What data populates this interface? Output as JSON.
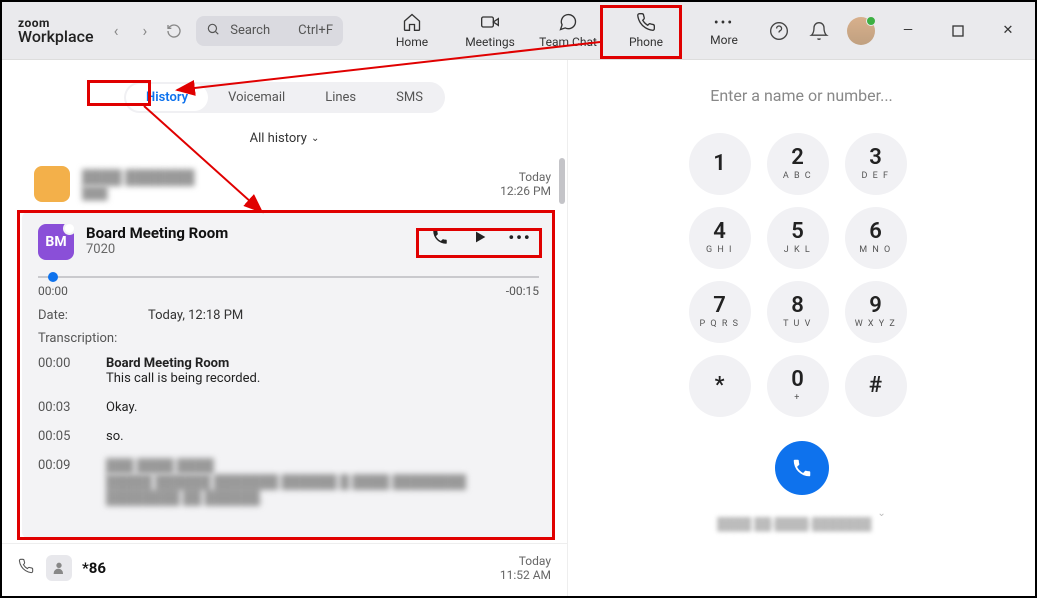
{
  "app": {
    "brand_top": "zoom",
    "brand_bottom": "Workplace"
  },
  "search": {
    "label": "Search",
    "shortcut": "Ctrl+F"
  },
  "nav": {
    "home": "Home",
    "meetings": "Meetings",
    "team_chat": "Team Chat",
    "phone": "Phone",
    "more": "More"
  },
  "sub_tabs": {
    "history": "History",
    "voicemail": "Voicemail",
    "lines": "Lines",
    "sms": "SMS"
  },
  "filter": {
    "label": "All history"
  },
  "entries": {
    "first": {
      "name": "████ ███████",
      "ext": "███",
      "time_day": "Today",
      "time_clock": "12:26 PM"
    },
    "last": {
      "name": "*86",
      "time_day": "Today",
      "time_clock": "11:52 AM"
    }
  },
  "detail": {
    "initials": "BM",
    "name": "Board Meeting Room",
    "ext": "7020",
    "progress": {
      "elapsed": "00:00",
      "remaining": "-00:15"
    },
    "date_label": "Date:",
    "date_value": "Today, 12:18 PM",
    "transcription_label": "Transcription:",
    "lines": [
      {
        "ts": "00:00",
        "speaker": "Board Meeting Room",
        "text": "This call is being recorded."
      },
      {
        "ts": "00:03",
        "speaker": "",
        "text": "Okay."
      },
      {
        "ts": "00:05",
        "speaker": "",
        "text": "so."
      },
      {
        "ts": "00:09",
        "speaker": "███ ████ ████",
        "text": "█████ ██████ ███████ ██████ █ ████ ████████ ████████ ██ ██████."
      }
    ]
  },
  "dialer": {
    "placeholder": "Enter a name or number...",
    "keys": [
      {
        "n": "1",
        "l": ""
      },
      {
        "n": "2",
        "l": "A B C"
      },
      {
        "n": "3",
        "l": "D E F"
      },
      {
        "n": "4",
        "l": "G H I"
      },
      {
        "n": "5",
        "l": "J K L"
      },
      {
        "n": "6",
        "l": "M N O"
      },
      {
        "n": "7",
        "l": "P Q R S"
      },
      {
        "n": "8",
        "l": "T U V"
      },
      {
        "n": "9",
        "l": "W X Y Z"
      },
      {
        "n": "*",
        "l": ""
      },
      {
        "n": "0",
        "l": "+"
      },
      {
        "n": "#",
        "l": ""
      }
    ],
    "caller_id": "████ ██-████-███████"
  }
}
